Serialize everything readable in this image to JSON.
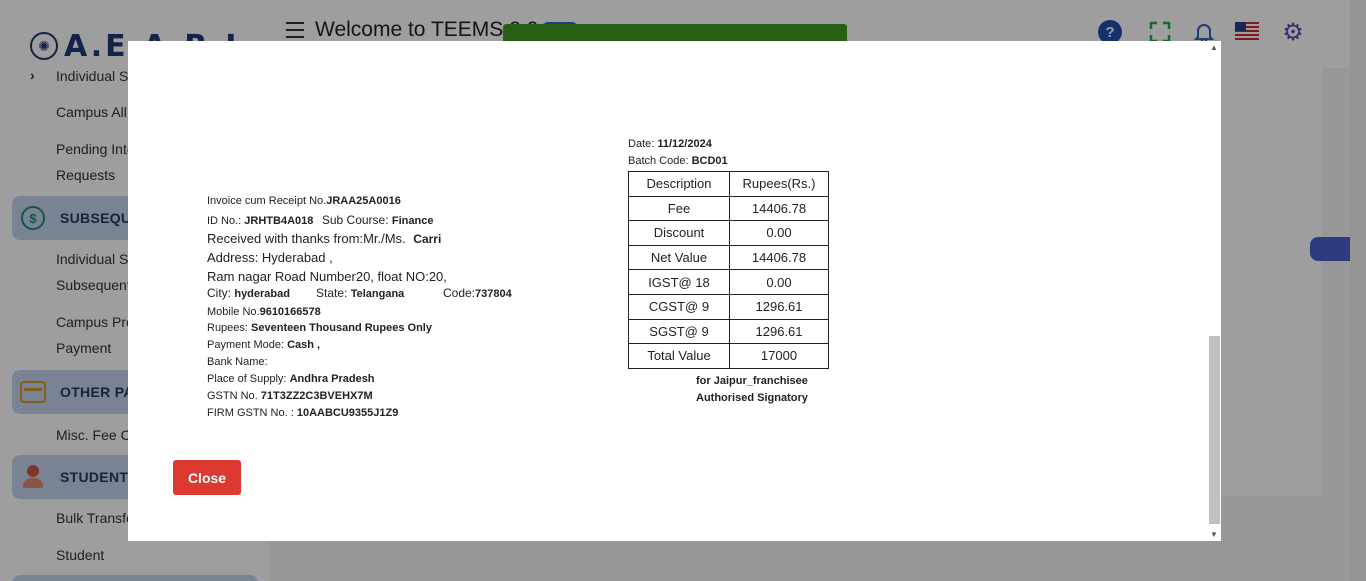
{
  "app": {
    "logo_text": "A.E.A.R.I",
    "welcome_title": "Welcome to TEEMS 2.0"
  },
  "sidebar": {
    "items": [
      "Individual S",
      "Campus All",
      "Pending Inte",
      "Requests",
      "Individual S",
      "Subsequent",
      "Campus Pro",
      "Payment",
      "Misc. Fee C",
      "Bulk Transfe",
      "Student"
    ],
    "sections": [
      "SUBSEQUEN",
      "OTHER PA",
      "STUDENT M"
    ]
  },
  "invoice": {
    "receipt_label": "Invoice cum Receipt No.",
    "receipt_no": "JRAA25A0016",
    "id_label": "ID No.: ",
    "id_no": "JRHTB4A018",
    "subcourse_label": "Sub Course: ",
    "subcourse": "Finance",
    "received_label": "Received with thanks from:Mr./Ms.",
    "received_name": "Carri",
    "address_line1": "Address: Hyderabad ,",
    "address_line2": "Ram nagar Road Number20, float NO:20,",
    "city_label": "City: ",
    "city": "hyderabad",
    "state_label": "State: ",
    "state": "Telangana",
    "code_label": "Code:",
    "code": "737804",
    "mobile_label": "Mobile No.",
    "mobile": "9610166578",
    "rupees_label": "Rupees: ",
    "rupees_words": "Seventeen Thousand Rupees Only",
    "payment_mode_label": "Payment Mode: ",
    "payment_mode": "Cash ,",
    "bank_label": "Bank Name:",
    "supply_label": "Place of Supply: ",
    "supply": "Andhra Pradesh",
    "gstn_label": "GSTN No. ",
    "gstn": "71T3ZZ2C3BVEHX7M",
    "firm_gstn_label": "FIRM GSTN No. : ",
    "firm_gstn": "10AABCU9355J1Z9",
    "date_label": "Date: ",
    "date": "11/12/2024",
    "batch_label": "Batch Code: ",
    "batch": "BCD01",
    "table_headers": [
      "Description",
      "Rupees(Rs.)"
    ],
    "table_rows": [
      [
        "Fee",
        "14406.78"
      ],
      [
        "Discount",
        "0.00"
      ],
      [
        "Net Value",
        "14406.78"
      ],
      [
        "IGST@ 18",
        "0.00"
      ],
      [
        "CGST@ 9",
        "1296.61"
      ],
      [
        "SGST@ 9",
        "1296.61"
      ],
      [
        "Total Value",
        "17000"
      ]
    ],
    "signatory_for": "for Jaipur_franchisee",
    "signatory_title": "Authorised Signatory"
  },
  "modal": {
    "close_label": "Close"
  }
}
